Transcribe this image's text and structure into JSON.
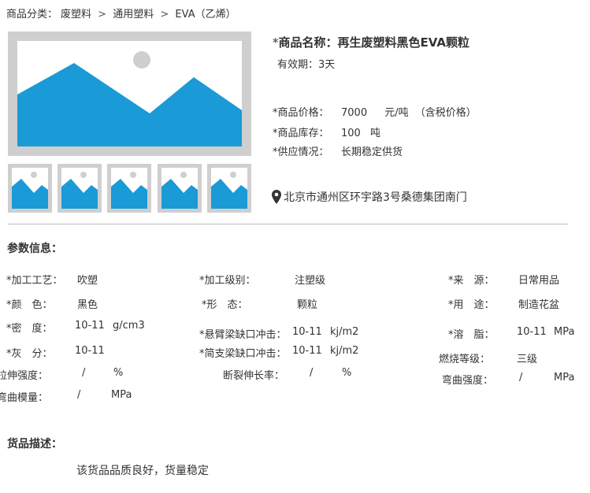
{
  "breadcrumb": {
    "label": "商品分类：",
    "items": [
      "废塑料",
      "通用塑料",
      "EVA（乙烯）"
    ],
    "separator": ">"
  },
  "product": {
    "title_star": "*",
    "title": "商品名称：再生废塑料黑色EVA颗粒",
    "validity": "有效期：3天",
    "price_label": "*商品价格：",
    "price_value": "7000",
    "price_unit": "元/吨",
    "price_note": "（含税价格）",
    "stock_label": "*商品库存：",
    "stock_value": "100",
    "stock_unit": "吨",
    "supply_label": "*供应情况：",
    "supply_value": "长期稳定供货",
    "address": "北京市通州区环宇路3号桑德集团南门"
  },
  "params": {
    "section_title": "参数信息：",
    "process_label": "*加工工艺：",
    "process_value": "吹塑",
    "grade_label": "*加工级别：",
    "grade_value": "注塑级",
    "source_label": "*来　源：",
    "source_value": "日常用品",
    "color_label": "*颜　色：",
    "color_value": "黑色",
    "form_label": "*形　态：",
    "form_value": "颗粒",
    "usage_label": "*用　途：",
    "usage_value": "制造花盆",
    "density_label": "*密　度：",
    "density_value": "10-11",
    "density_unit": "g/cm3",
    "cantilever_label": "*悬臂梁缺口冲击：",
    "cantilever_value": "10-11",
    "cantilever_unit": "kj/m2",
    "melt_label": "*溶　脂：",
    "melt_value": "10-11",
    "melt_unit": "MPa",
    "ash_label": "*灰　分：",
    "ash_value": "10-11",
    "simple_label": "*简支梁缺口冲击：",
    "simple_value": "10-11",
    "simple_unit": "kj/m2",
    "flame_label": "燃烧等级：",
    "flame_value": "三级",
    "tensile_label": "拉伸强度：",
    "tensile_value": "/",
    "tensile_unit": "%",
    "elong_label": "断裂伸长率：",
    "elong_value": "/",
    "elong_unit": "%",
    "flex_str_label": "弯曲强度：",
    "flex_str_value": "/",
    "flex_str_unit": "MPa",
    "flex_mod_label": "弯曲模量：",
    "flex_mod_value": "/",
    "flex_mod_unit": "MPa"
  },
  "description": {
    "section_title": "货品描述：",
    "text": "该货品品质良好，货量稳定"
  },
  "colors": {
    "image_frame": "#cfcfcf",
    "image_blue": "#1a9ad6",
    "image_sun": "#cfcfcf",
    "divider": "#bbbbbb"
  },
  "icons": {
    "image_placeholder": "landscape-placeholder-icon",
    "location": "map-pin-icon"
  }
}
